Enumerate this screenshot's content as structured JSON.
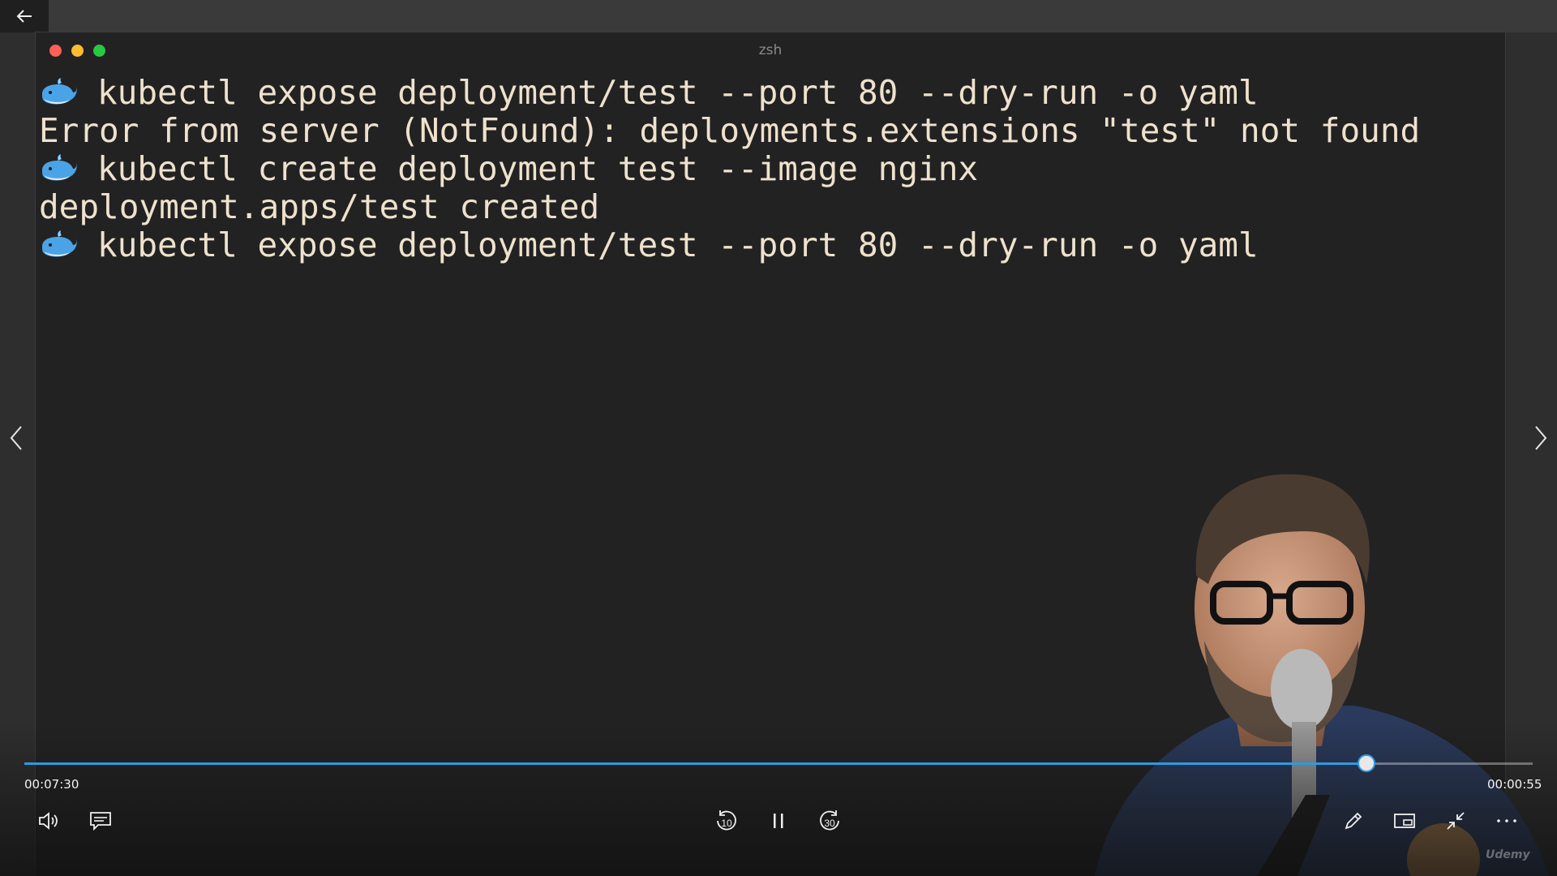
{
  "terminal": {
    "title": "zsh",
    "lines": [
      {
        "type": "prompt",
        "text": "kubectl expose deployment/test --port 80 --dry-run -o yaml"
      },
      {
        "type": "output",
        "text": "Error from server (NotFound): deployments.extensions \"test\" not found"
      },
      {
        "type": "prompt",
        "text": "kubectl create deployment test --image nginx"
      },
      {
        "type": "output",
        "text": "deployment.apps/test created"
      },
      {
        "type": "prompt",
        "text": "kubectl expose deployment/test --port 80 --dry-run -o yaml"
      }
    ]
  },
  "player": {
    "elapsed": "00:07:30",
    "remaining": "00:00:55",
    "progress": 0.89,
    "accent_color": "#2f9ae0",
    "skip_back_seconds": "10",
    "skip_forward_seconds": "30",
    "watermark": "Udemy"
  },
  "icons": {
    "back": "arrow-left-icon",
    "prev": "chevron-left-icon",
    "next": "chevron-right-icon",
    "volume": "volume-icon",
    "captions": "captions-icon",
    "skip_back": "replay-10-icon",
    "pause": "pause-icon",
    "skip_forward": "forward-30-icon",
    "annotate": "pencil-icon",
    "mini_player": "mini-player-icon",
    "exit_fullscreen": "exit-fullscreen-icon",
    "more": "more-icon"
  }
}
